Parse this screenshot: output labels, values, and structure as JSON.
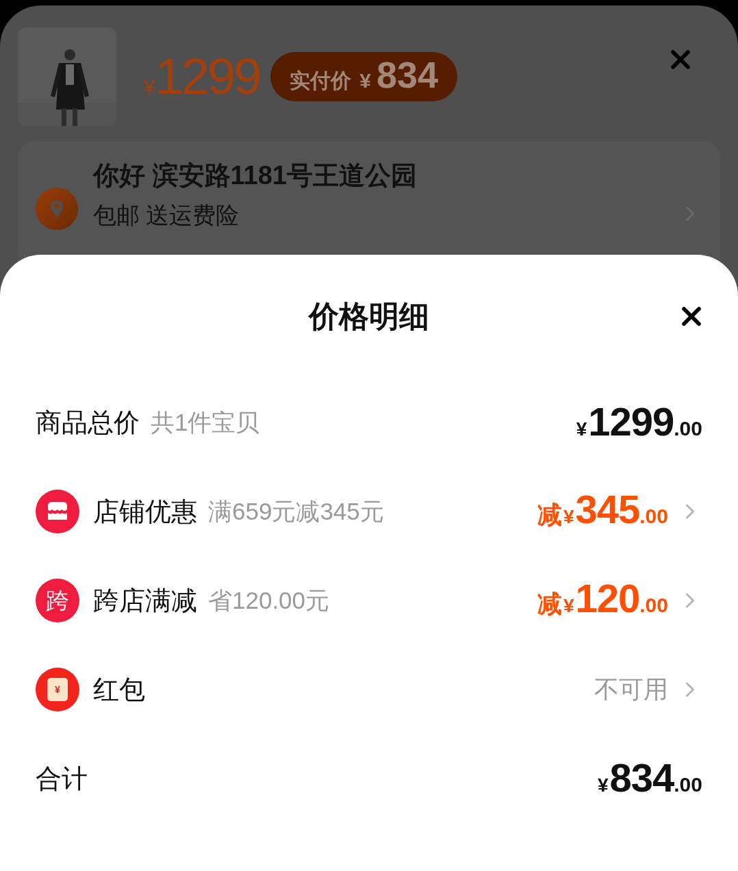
{
  "header": {
    "price_currency": "¥",
    "price": "1299",
    "paid_badge": {
      "label": "实付价",
      "currency": "¥",
      "amount": "834"
    }
  },
  "address": {
    "title": "你好 滨安路1181号王道公园",
    "subtitle": "包邮 送运费险"
  },
  "sheet": {
    "title": "价格明细",
    "rows": [
      {
        "kind": "price",
        "label": "商品总价",
        "note": "共1件宝贝",
        "amount": {
          "currency": "¥",
          "integer": "1299",
          "decimal": ".00"
        },
        "chevron": false
      },
      {
        "kind": "discount",
        "icon": {
          "kind": "store"
        },
        "label": "店铺优惠",
        "note": "满659元减345元",
        "amount": {
          "prefix": "减",
          "currency": "¥",
          "integer": "345",
          "decimal": ".00"
        },
        "chevron": true
      },
      {
        "kind": "discount",
        "icon": {
          "kind": "text",
          "text": "跨"
        },
        "label": "跨店满减",
        "note": "省120.00元",
        "amount": {
          "prefix": "减",
          "currency": "¥",
          "integer": "120",
          "decimal": ".00"
        },
        "chevron": true
      },
      {
        "kind": "status",
        "icon": {
          "kind": "red_packet",
          "text": "¥"
        },
        "label": "红包",
        "value": "不可用",
        "chevron": true
      },
      {
        "kind": "price",
        "label": "合计",
        "amount": {
          "currency": "¥",
          "integer": "834",
          "decimal": ".00"
        },
        "chevron": false
      }
    ]
  }
}
